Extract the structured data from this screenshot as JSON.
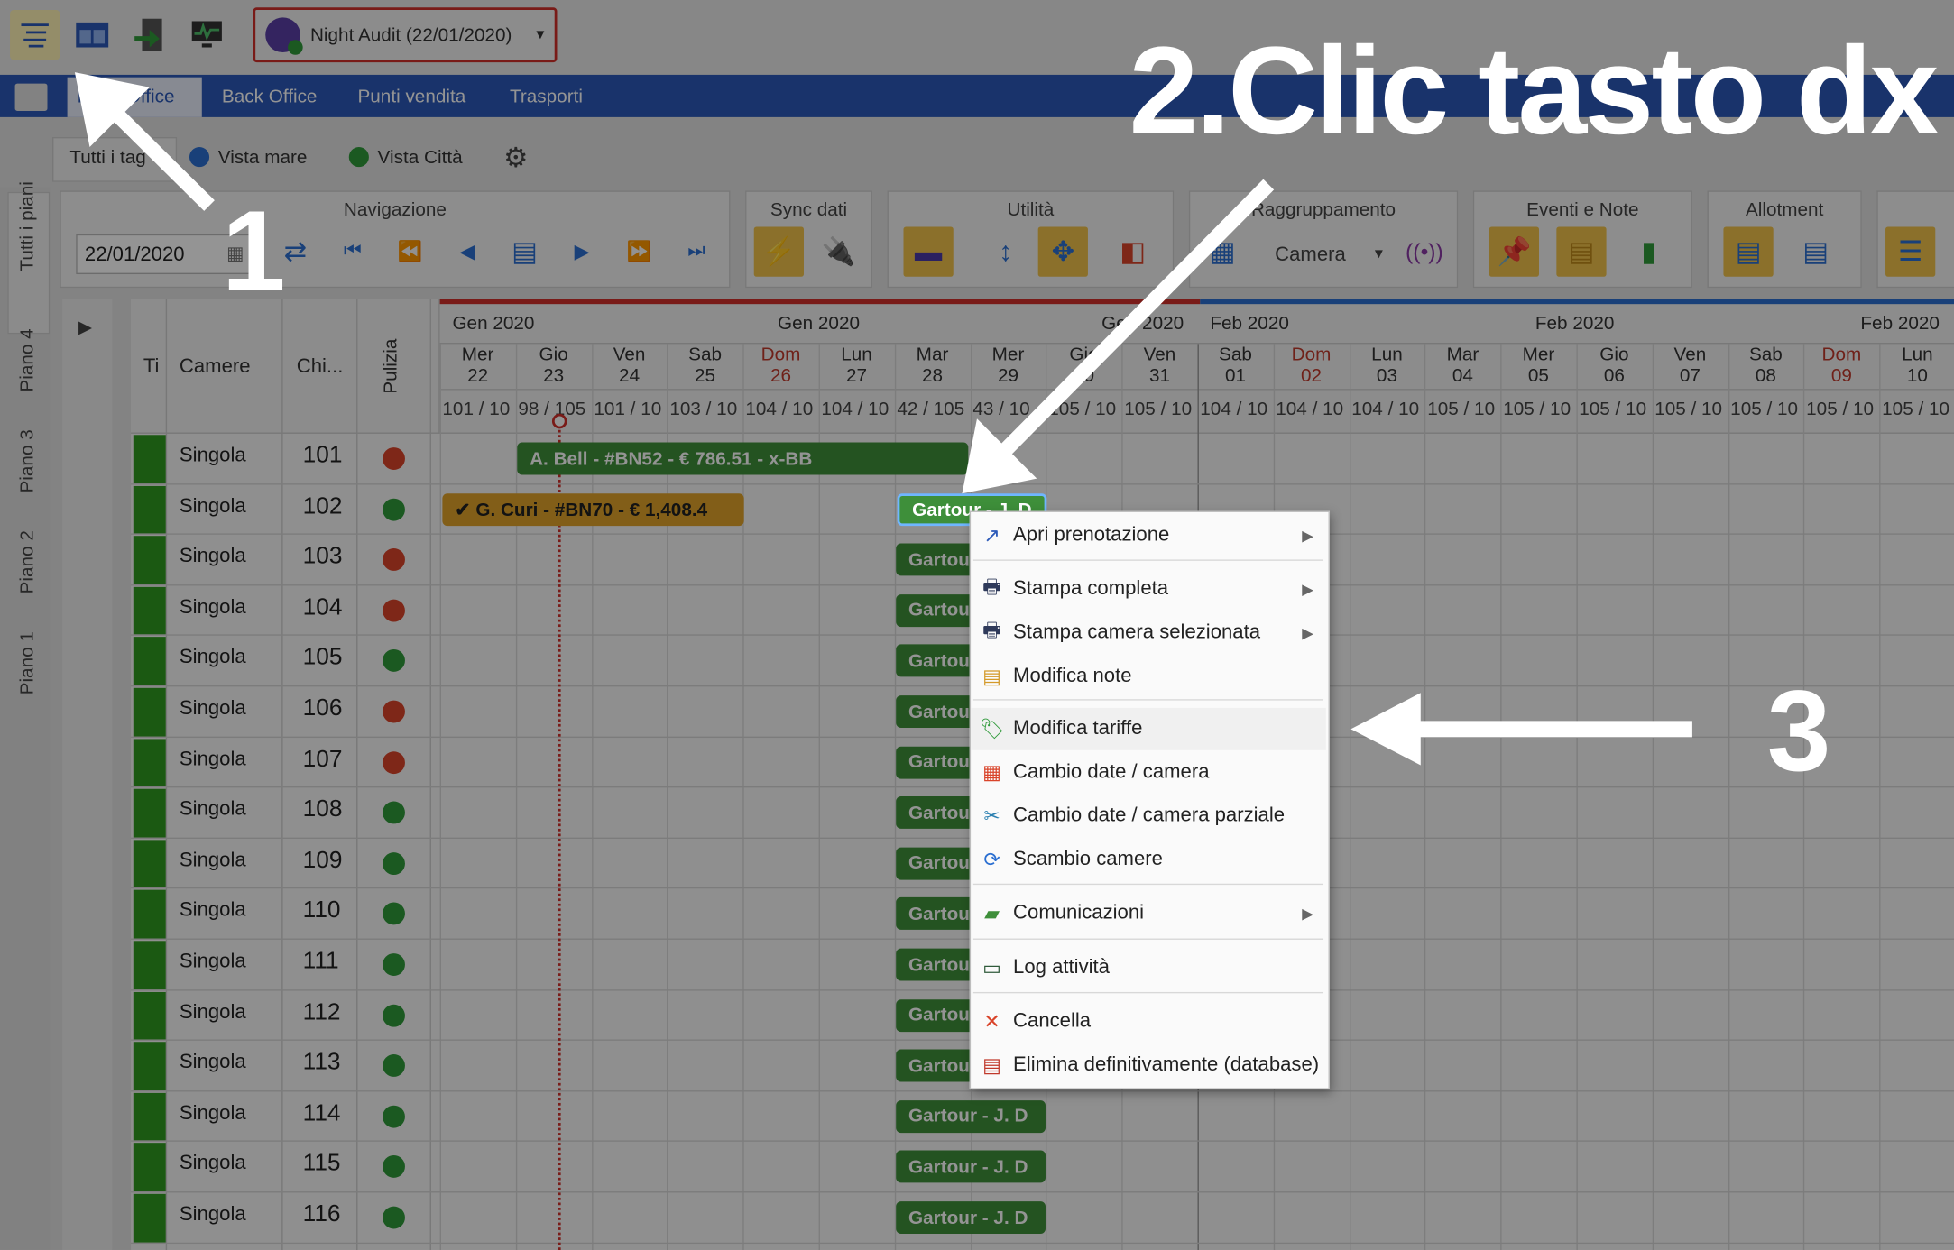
{
  "topbar": {
    "night_audit": "Night Audit (22/01/2020)"
  },
  "nav": {
    "items": [
      "Front Office",
      "Back Office",
      "Punti vendita",
      "Trasporti"
    ]
  },
  "filters": {
    "all_tags": "Tutti i tag",
    "vista_mare": "Vista mare",
    "vista_citta": "Vista Città"
  },
  "toolbar": {
    "navigazione": "Navigazione",
    "date_value": "22/01/2020",
    "sync": "Sync dati",
    "utilita": "Utilità",
    "raggruppamento": "Raggruppamento",
    "group_by": "Camera",
    "eventi": "Eventi e Note",
    "allotment": "Allotment"
  },
  "floors": [
    "Tutti i piani",
    "Piano 4",
    "Piano 3",
    "Piano 2",
    "Piano 1"
  ],
  "grid": {
    "col_headers": {
      "t": "Ti",
      "camere": "Camere",
      "chiave": "Chi...",
      "pulizia": "Pulizia"
    },
    "months": [
      {
        "label": "Gen 2020"
      },
      {
        "label": "Gen 2020"
      },
      {
        "label": "Gen 2020"
      },
      {
        "label": "Feb 2020"
      },
      {
        "label": "Feb 2020"
      },
      {
        "label": "Feb 2020"
      }
    ],
    "days": [
      {
        "dow": "Mer",
        "d": "22",
        "occ": "101 / 10"
      },
      {
        "dow": "Gio",
        "d": "23",
        "occ": "98 / 105"
      },
      {
        "dow": "Ven",
        "d": "24",
        "occ": "101 / 10"
      },
      {
        "dow": "Sab",
        "d": "25",
        "occ": "103 / 10"
      },
      {
        "dow": "Dom",
        "d": "26",
        "occ": "104 / 10",
        "sun": true
      },
      {
        "dow": "Lun",
        "d": "27",
        "occ": "104 / 10"
      },
      {
        "dow": "Mar",
        "d": "28",
        "occ": "42 / 105"
      },
      {
        "dow": "Mer",
        "d": "29",
        "occ": "43 / 10"
      },
      {
        "dow": "Gio",
        "d": "30",
        "occ": "105 / 10"
      },
      {
        "dow": "Ven",
        "d": "31",
        "occ": "105 / 10"
      },
      {
        "dow": "Sab",
        "d": "01",
        "occ": "104 / 10"
      },
      {
        "dow": "Dom",
        "d": "02",
        "occ": "104 / 10",
        "sun": true
      },
      {
        "dow": "Lun",
        "d": "03",
        "occ": "104 / 10"
      },
      {
        "dow": "Mar",
        "d": "04",
        "occ": "105 / 10"
      },
      {
        "dow": "Mer",
        "d": "05",
        "occ": "105 / 10"
      },
      {
        "dow": "Gio",
        "d": "06",
        "occ": "105 / 10"
      },
      {
        "dow": "Ven",
        "d": "07",
        "occ": "105 / 10"
      },
      {
        "dow": "Sab",
        "d": "08",
        "occ": "105 / 10"
      },
      {
        "dow": "Dom",
        "d": "09",
        "occ": "105 / 10",
        "sun": true
      },
      {
        "dow": "Lun",
        "d": "10",
        "occ": "105 / 10"
      }
    ],
    "rooms": [
      {
        "type": "Singola",
        "num": "101",
        "clean": "dirty"
      },
      {
        "type": "Singola",
        "num": "102",
        "clean": "clean"
      },
      {
        "type": "Singola",
        "num": "103",
        "clean": "dirty"
      },
      {
        "type": "Singola",
        "num": "104",
        "clean": "dirty"
      },
      {
        "type": "Singola",
        "num": "105",
        "clean": "clean"
      },
      {
        "type": "Singola",
        "num": "106",
        "clean": "dirty"
      },
      {
        "type": "Singola",
        "num": "107",
        "clean": "dirty"
      },
      {
        "type": "Singola",
        "num": "108",
        "clean": "clean"
      },
      {
        "type": "Singola",
        "num": "109",
        "clean": "clean"
      },
      {
        "type": "Singola",
        "num": "110",
        "clean": "clean"
      },
      {
        "type": "Singola",
        "num": "111",
        "clean": "clean"
      },
      {
        "type": "Singola",
        "num": "112",
        "clean": "clean"
      },
      {
        "type": "Singola",
        "num": "113",
        "clean": "clean"
      },
      {
        "type": "Singola",
        "num": "114",
        "clean": "clean"
      },
      {
        "type": "Singola",
        "num": "115",
        "clean": "clean"
      },
      {
        "type": "Singola",
        "num": "116",
        "clean": "clean"
      }
    ],
    "bookings": {
      "bell": "A. Bell - #BN52 - € 786.51 - x-BB",
      "curi": "✔ G. Curi - #BN70 - € 1,408.4",
      "gartour_selected": "Gartour - J. D",
      "gartour": "Gartour - J. D"
    }
  },
  "context_menu": {
    "items": [
      {
        "label": "Apri prenotazione",
        "icon": "open-icon",
        "sub": true
      },
      {
        "label": "Stampa completa",
        "icon": "printer-icon",
        "sub": true
      },
      {
        "label": "Stampa camera selezionata",
        "icon": "printer-icon",
        "sub": true
      },
      {
        "label": "Modifica note",
        "icon": "note-icon",
        "sub": false
      },
      {
        "label": "Modifica tariffe",
        "icon": "price-tag-icon",
        "sub": false
      },
      {
        "label": "Cambio date / camera",
        "icon": "calendar-icon",
        "sub": false
      },
      {
        "label": "Cambio date / camera parziale",
        "icon": "scissors-icon",
        "sub": false
      },
      {
        "label": "Scambio camere",
        "icon": "swap-icon",
        "sub": false
      },
      {
        "label": "Comunicazioni",
        "icon": "chat-icon",
        "sub": true
      },
      {
        "label": "Log attività",
        "icon": "monitor-icon",
        "sub": false
      },
      {
        "label": "Cancella",
        "icon": "delete-icon",
        "sub": false
      },
      {
        "label": "Elimina definitivamente (database)",
        "icon": "database-delete-icon",
        "sub": false
      }
    ]
  },
  "annotations": {
    "step1": "1",
    "step2": "2.Clic tasto dx",
    "step3": "3"
  },
  "colors": {
    "nav_blue": "#2b59b8",
    "booking_green": "#3e8f3a",
    "booking_orange": "#e0a32a",
    "dirty_red": "#d9442a",
    "clean_green": "#2f9a3a",
    "room_bar_green": "#2f9a1f"
  }
}
